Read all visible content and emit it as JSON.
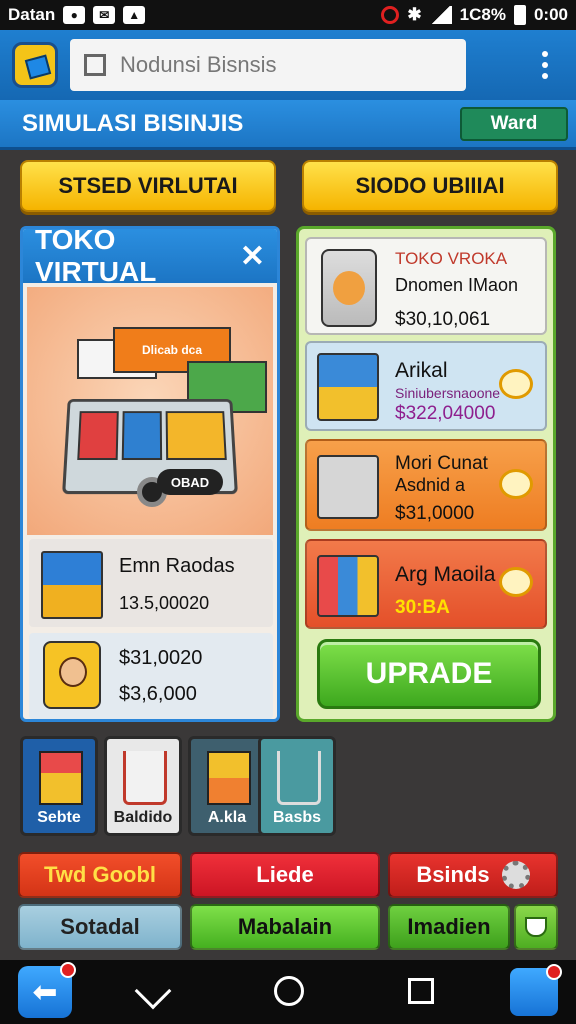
{
  "status_bar": {
    "carrier": "Datan",
    "battery": "1C8%",
    "time": "0:00"
  },
  "app_bar": {
    "search_placeholder": "Nodunsi Bisnsis"
  },
  "title_bar": {
    "title": "SIMULASI BISINJIS",
    "button": "Ward"
  },
  "top_buttons": [
    {
      "label": "STSED VIRLUTAI"
    },
    {
      "label": "SIODO UBIIIAI"
    }
  ],
  "left_card": {
    "title": "TOKO VIRTUAL",
    "close": "✕",
    "cart_tag": "OBAD",
    "box_label": "Dlicab dca",
    "item1": {
      "name": "Emn Raodas",
      "price": "13.5,00020"
    },
    "item2": {
      "price_a": "$31,0020",
      "price_b": "$3,6,000"
    }
  },
  "right_card": {
    "items": [
      {
        "title": "TOKO VROKA",
        "subtitle": "Dnomen IMaon",
        "price": "$30,10,061"
      },
      {
        "title": "Arikal",
        "subtitle": "Siniubersnaoone",
        "price": "$322,04000"
      },
      {
        "title": "Mori Cunat",
        "subtitle": "Asdnid a",
        "price": "$31,0000"
      },
      {
        "title": "Arg Maoila",
        "subtitle": "",
        "price": "30:BA"
      }
    ],
    "upgrade_label": "UPRADE"
  },
  "tiles": [
    {
      "label": "Sebte"
    },
    {
      "label": "Baldido"
    },
    {
      "label": "A.kla"
    },
    {
      "label": "Basbs"
    }
  ],
  "action_buttons": {
    "row1": [
      "Twd Goobl",
      "Liede",
      "Bsinds"
    ],
    "row2": [
      "Sotadal",
      "Mabalain",
      "Imadien"
    ]
  },
  "colors": {
    "primary_blue": "#1c75c4",
    "accent_yellow": "#f5b400",
    "green": "#3da81e",
    "red": "#e01e2a"
  }
}
